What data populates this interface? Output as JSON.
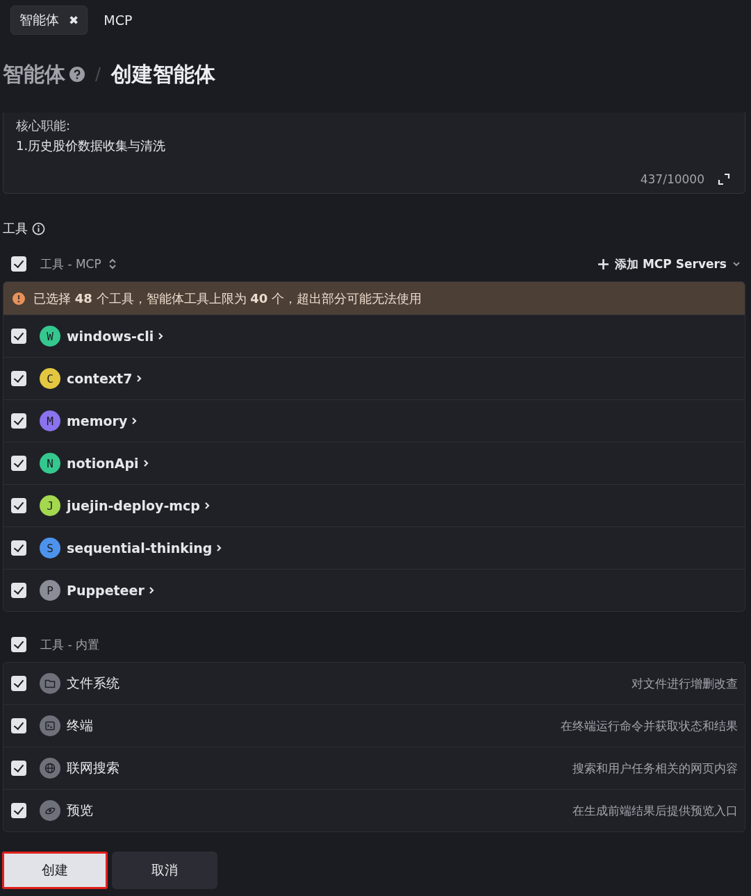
{
  "tabs": [
    {
      "label": "智能体",
      "selected": true,
      "close": "✖"
    },
    {
      "label": "MCP",
      "selected": false
    }
  ],
  "breadcrumb": {
    "parent": "智能体",
    "current": "创建智能体"
  },
  "prompt": {
    "lines": [
      "核心职能:",
      "1.历史股价数据收集与清洗"
    ],
    "counter": "437/10000"
  },
  "tools_label": "工具",
  "mcp_group": {
    "label": "工具 - MCP",
    "checked": true,
    "add_button": "添加 MCP Servers",
    "warning": "已选择 **48** 个工具，智能体工具上限为 **40** 个，超出部分可能无法使用",
    "servers": [
      {
        "initial": "W",
        "name": "windows-cli",
        "color": "#34c88f",
        "checked": true
      },
      {
        "initial": "C",
        "name": "context7",
        "color": "#e3c740",
        "checked": true
      },
      {
        "initial": "M",
        "name": "memory",
        "color": "#8b72ee",
        "checked": true
      },
      {
        "initial": "N",
        "name": "notionApi",
        "color": "#34c88f",
        "checked": true
      },
      {
        "initial": "J",
        "name": "juejin-deploy-mcp",
        "color": "#a4d84e",
        "checked": true
      },
      {
        "initial": "S",
        "name": "sequential-thinking",
        "color": "#4d93ee",
        "checked": true
      },
      {
        "initial": "P",
        "name": "Puppeteer",
        "color": "#8a8d96",
        "checked": true
      }
    ]
  },
  "builtin_group": {
    "label": "工具 - 内置",
    "checked": true,
    "tools": [
      {
        "kind": "folder",
        "name": "文件系统",
        "description": "对文件进行增删改查",
        "checked": true
      },
      {
        "kind": "terminal",
        "name": "终端",
        "description": "在终端运行命令并获取状态和结果",
        "checked": true
      },
      {
        "kind": "globe",
        "name": "联网搜索",
        "description": "搜索和用户任务相关的网页内容",
        "checked": true
      },
      {
        "kind": "eye",
        "name": "预览",
        "description": "在生成前端结果后提供预览入口",
        "checked": true
      }
    ]
  },
  "buttons": [
    {
      "label": "创建",
      "kind": "primary",
      "highlighted": true
    },
    {
      "label": "取消",
      "kind": "secondary",
      "highlighted": false
    }
  ]
}
